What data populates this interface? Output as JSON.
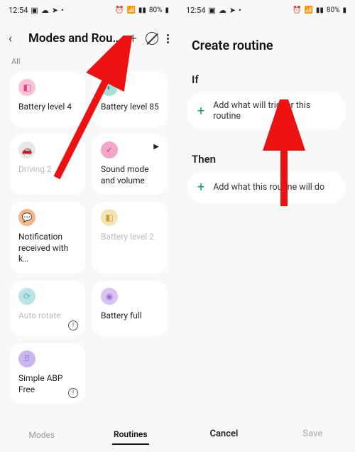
{
  "statusbar": {
    "time": "12:54",
    "battery": "80%"
  },
  "phone1": {
    "title": "Modes and Rou…",
    "all": "All",
    "cards": [
      {
        "title": "Battery level 4",
        "iconColor": "c-pink"
      },
      {
        "title": "Battery level 85",
        "iconColor": "c-teal"
      },
      {
        "title": "Driving 2",
        "iconColor": "c-grey",
        "disabled": true
      },
      {
        "title": "Sound mode and volume",
        "iconColor": "c-pink2",
        "play": true
      },
      {
        "title": "Notification received with k…",
        "iconColor": "c-orange"
      },
      {
        "title": "Battery level 2",
        "iconColor": "c-yellow",
        "disabled": true
      },
      {
        "title": "Auto rotate",
        "iconColor": "c-cyan",
        "disabled": true,
        "warn": true
      },
      {
        "title": "Battery full",
        "iconColor": "c-purple"
      },
      {
        "title": "Simple ABP Free",
        "iconColor": "c-violet",
        "warn": true
      }
    ],
    "tabs": {
      "modes": "Modes",
      "routines": "Routines"
    }
  },
  "phone2": {
    "title": "Create routine",
    "if_label": "If",
    "if_text": "Add what will trigger this routine",
    "then_label": "Then",
    "then_text": "Add what this routine will do",
    "cancel": "Cancel",
    "save": "Save"
  }
}
